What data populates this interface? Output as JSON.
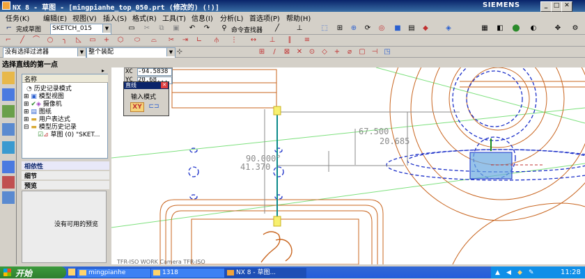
{
  "window": {
    "title": "NX 8 - 草图 - [mingpianhe_top_050.prt  (修改的)    (!)]",
    "brand": "SIEMENS"
  },
  "menu": [
    "任务(K)",
    "编辑(E)",
    "视图(V)",
    "插入(S)",
    "格式(R)",
    "工具(T)",
    "信息(I)",
    "分析(L)",
    "首选项(P)",
    "帮助(H)"
  ],
  "toolbar1": {
    "finish_sketch": "完成草图",
    "sketch_name": "SKETCH_015",
    "command_finder": "命令查找器"
  },
  "toolbar3": {
    "filter": "没有选择过滤器",
    "assembly_scope": "整个装配"
  },
  "status": {
    "prompt": "选择直线的第一点"
  },
  "navigator": {
    "header": "名称",
    "items": [
      {
        "label": "历史记录模式"
      },
      {
        "label": "模型视图"
      },
      {
        "label": "摄像机"
      },
      {
        "label": "图纸"
      },
      {
        "label": "用户表达式"
      },
      {
        "label": "模型历史记录"
      },
      {
        "label": "草图 (0) \"SKET..."
      }
    ],
    "sections": [
      "相依性",
      "细节",
      "预览"
    ],
    "preview_empty": "没有可用的预览"
  },
  "line_dialog": {
    "title": "直线",
    "input_mode_label": "输入模式",
    "xy_label": "XY"
  },
  "coords": {
    "xc_label": "XC",
    "xc_value": "-94.5838",
    "yc_label": "YC",
    "yc_value": "20.68..."
  },
  "dimensions": [
    "67.500",
    "20.685",
    "90.000°",
    "41.370"
  ],
  "view_label": "TFR-ISO WORK Camera TFR-ISO",
  "taskbar": {
    "start": "开始",
    "tasks": [
      "mingpianhe",
      "1318",
      "NX 8 - 草图..."
    ],
    "clock": "11:28"
  },
  "colors": {
    "title_bar": "#0a246a",
    "sketch_geometry": "#c8641e",
    "dashed_curves": "#1a2ec8",
    "dimension_gray": "#8a8a8a",
    "selected_line": "#0a8a8a",
    "taskbar": "#245edb"
  }
}
